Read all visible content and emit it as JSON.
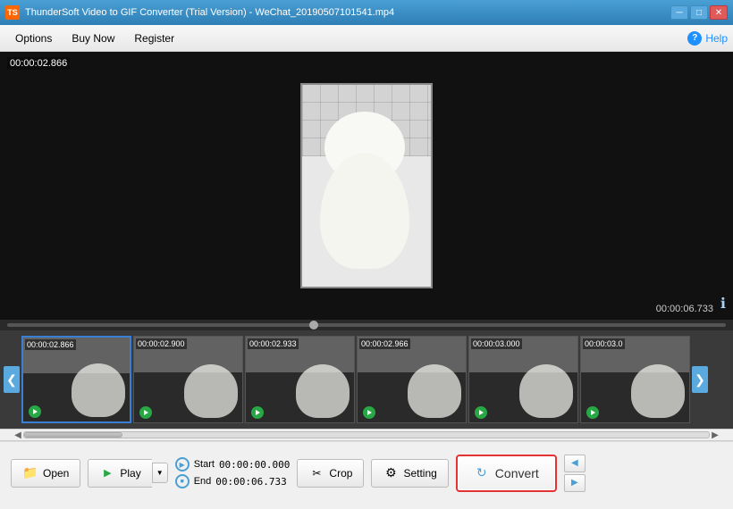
{
  "titleBar": {
    "title": "ThunderSoft Video to GIF Converter (Trial Version) - WeChat_20190507101541.mp4",
    "icon": "TS",
    "controls": {
      "minimize": "─",
      "maximize": "□",
      "close": "✕"
    }
  },
  "menuBar": {
    "items": [
      "Options",
      "Buy Now",
      "Register"
    ],
    "help": "Help",
    "helpLabel": "?"
  },
  "videoArea": {
    "timestamp": "00:00:02.866",
    "totalTime": "00:00:06.733",
    "infoIcon": "ℹ"
  },
  "thumbnails": [
    {
      "time": "00:00:02.866",
      "selected": true
    },
    {
      "time": "00:00:02.900",
      "selected": false
    },
    {
      "time": "00:00:02.933",
      "selected": false
    },
    {
      "time": "00:00:02.966",
      "selected": false
    },
    {
      "time": "00:00:03.000",
      "selected": false
    },
    {
      "time": "00:00:03.0",
      "selected": false
    }
  ],
  "bottomControls": {
    "openLabel": "Open",
    "playLabel": "Play",
    "startLabel": "Start",
    "startTime": "00:00:00.000",
    "endLabel": "End",
    "endTime": "00:00:06.733",
    "cropLabel": "Crop",
    "settingLabel": "Setting",
    "convertLabel": "Convert",
    "prevLabel": "◀",
    "nextLabel": "▶"
  }
}
